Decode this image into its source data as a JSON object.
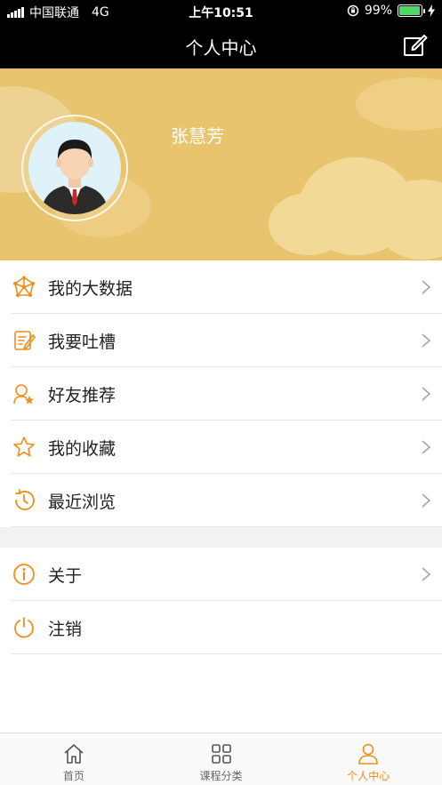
{
  "status_bar": {
    "carrier": "中国联通",
    "network": "4G",
    "time": "上午10:51",
    "battery": "99%"
  },
  "nav": {
    "title": "个人中心",
    "edit_icon": "edit-icon"
  },
  "profile": {
    "username": "张慧芳",
    "avatar_icon": "user-avatar"
  },
  "menu_primary": [
    {
      "label": "我的大数据",
      "icon": "network-icon"
    },
    {
      "label": "我要吐槽",
      "icon": "note-edit-icon"
    },
    {
      "label": "好友推荐",
      "icon": "friend-star-icon"
    },
    {
      "label": "我的收藏",
      "icon": "star-icon"
    },
    {
      "label": "最近浏览",
      "icon": "history-icon"
    }
  ],
  "menu_secondary": [
    {
      "label": "关于",
      "icon": "info-icon"
    },
    {
      "label": "注销",
      "icon": "power-icon"
    }
  ],
  "tabs": [
    {
      "label": "首页",
      "icon": "home-icon",
      "active": false
    },
    {
      "label": "课程分类",
      "icon": "grid-icon",
      "active": false
    },
    {
      "label": "个人中心",
      "icon": "user-icon",
      "active": true
    }
  ],
  "colors": {
    "accent": "#f08c1a",
    "header_bg": "#e8c46e",
    "bar_bg": "#000000"
  }
}
